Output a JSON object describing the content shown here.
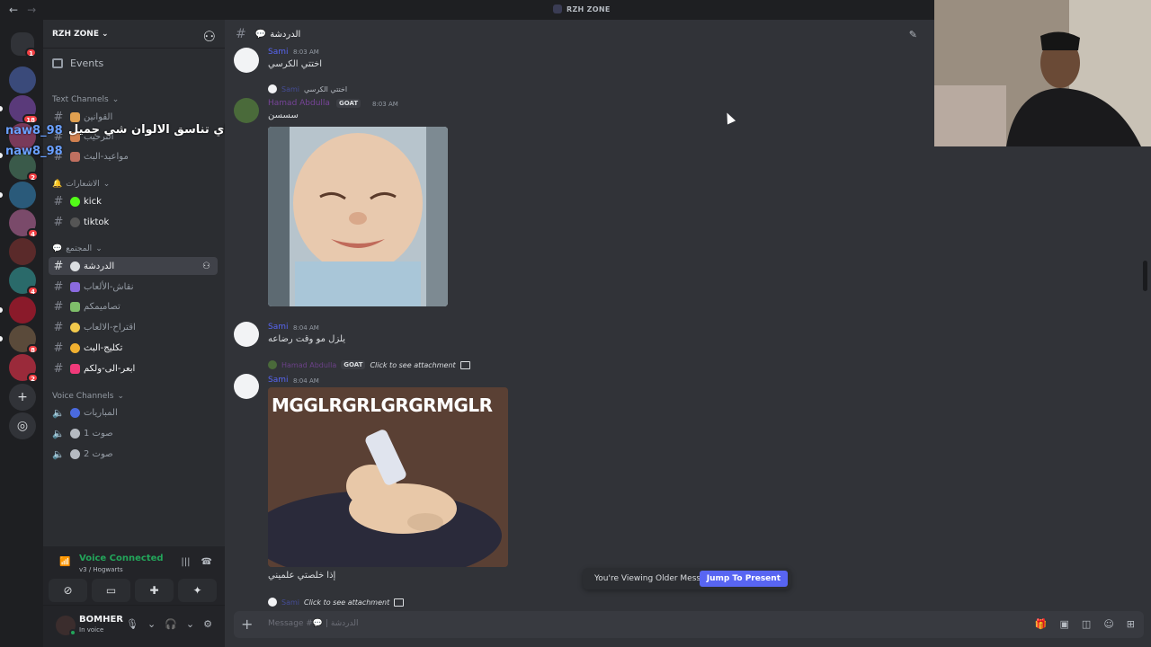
{
  "window": {
    "title": "RZH ZONE",
    "nav_back": "←",
    "nav_forward": "→"
  },
  "servers": [
    {
      "color": "#313338",
      "badge": "1",
      "icon": "discord-home-icon"
    },
    {
      "color": "#3a4a7a",
      "badge": "",
      "icon": "server-icon"
    },
    {
      "color": "#5a3a7a",
      "badge": "18",
      "icon": "server-icon"
    },
    {
      "color": "#7a3a5a",
      "badge": "",
      "icon": "server-icon"
    },
    {
      "color": "#3a5a4a",
      "badge": "2",
      "icon": "server-icon"
    },
    {
      "color": "#2a5a7a",
      "badge": "",
      "icon": "server-icon"
    },
    {
      "color": "#7a4a6a",
      "badge": "4",
      "icon": "server-icon"
    },
    {
      "color": "#5a2a2a",
      "badge": "",
      "icon": "server-icon"
    },
    {
      "color": "#2a6a6a",
      "badge": "4",
      "icon": "server-icon"
    },
    {
      "color": "#8a1a2a",
      "badge": "",
      "icon": "server-icon"
    },
    {
      "color": "#5a4a3a",
      "badge": "8",
      "icon": "server-icon"
    },
    {
      "color": "#9a2a3a",
      "badge": "2",
      "icon": "server-icon"
    }
  ],
  "guild": {
    "name": "RZH ZONE"
  },
  "sidebar": {
    "events_label": "Events",
    "category_text": "Text Channels",
    "category_notif": "الاشعارات",
    "category_community": "المجتمع",
    "category_voice": "Voice Channels",
    "channels": [
      {
        "label": "القوانين",
        "emoji": "#e0a050"
      },
      {
        "label": "الترحيب",
        "emoji": "#d08050"
      },
      {
        "label": "مواعيد-البث",
        "emoji": "#c07060"
      },
      {
        "label": "kick",
        "emoji": "#53fc18"
      },
      {
        "label": "tiktok",
        "emoji": "#555555"
      },
      {
        "label": "الدردشة",
        "emoji": "#dbdee1"
      },
      {
        "label": "نقاش-الألعاب",
        "emoji": "#8a6adf"
      },
      {
        "label": "تصاميمكم",
        "emoji": "#7fbf6a"
      },
      {
        "label": "اقتراح-الالعاب",
        "emoji": "#f2c94c"
      },
      {
        "label": "تكليج-البث",
        "emoji": "#f0b030"
      },
      {
        "label": "ابعر-الى-ولكم",
        "emoji": "#f03a7a"
      }
    ],
    "voice_channels": [
      {
        "label": "المباريات"
      },
      {
        "label": "صوت 1"
      },
      {
        "label": "صوت 2"
      }
    ]
  },
  "overlays": {
    "line1": "اي تناسق الالوان شي جميل",
    "line2": "naw8_98",
    "line3": "naw8_98"
  },
  "voice": {
    "status": "Voice Connected",
    "location": "v3 / Hogwarts"
  },
  "user": {
    "name": "BOMHER",
    "status": "In voice"
  },
  "header": {
    "channel": "الدردشة"
  },
  "messages": {
    "m1_user": "Sami",
    "m1_time": "8:03 AM",
    "m1_text": "اختتي الكرسي",
    "m2_reply_user": "Sami",
    "m2_reply_text": "اختتي الكرسي",
    "m2_user": "Hamad Abdulla",
    "m2_badge": "GOAT",
    "m2_time": "8:03 AM",
    "m2_text": "سسسن",
    "m3_user": "Sami",
    "m3_time": "8:04 AM",
    "m3_text": "يلزل مو وقت رضاعه",
    "m4_reply_user": "Hamad Abdulla",
    "m4_reply_badge": "GOAT",
    "m4_reply_text": "Click to see attachment",
    "m4_user": "Sami",
    "m4_time": "8:04 AM",
    "m4_image_caption": "MGGLRGRLGRGRMGLR",
    "m4_text": "إذا خلصتي علميني",
    "m5_reply_user": "Sami",
    "m5_reply_text": "Click to see attachment"
  },
  "jump": {
    "label": "You're Viewing Older Messages",
    "button": "Jump To Present"
  },
  "composer": {
    "placeholder": "Message #💬 | الدردشة"
  }
}
